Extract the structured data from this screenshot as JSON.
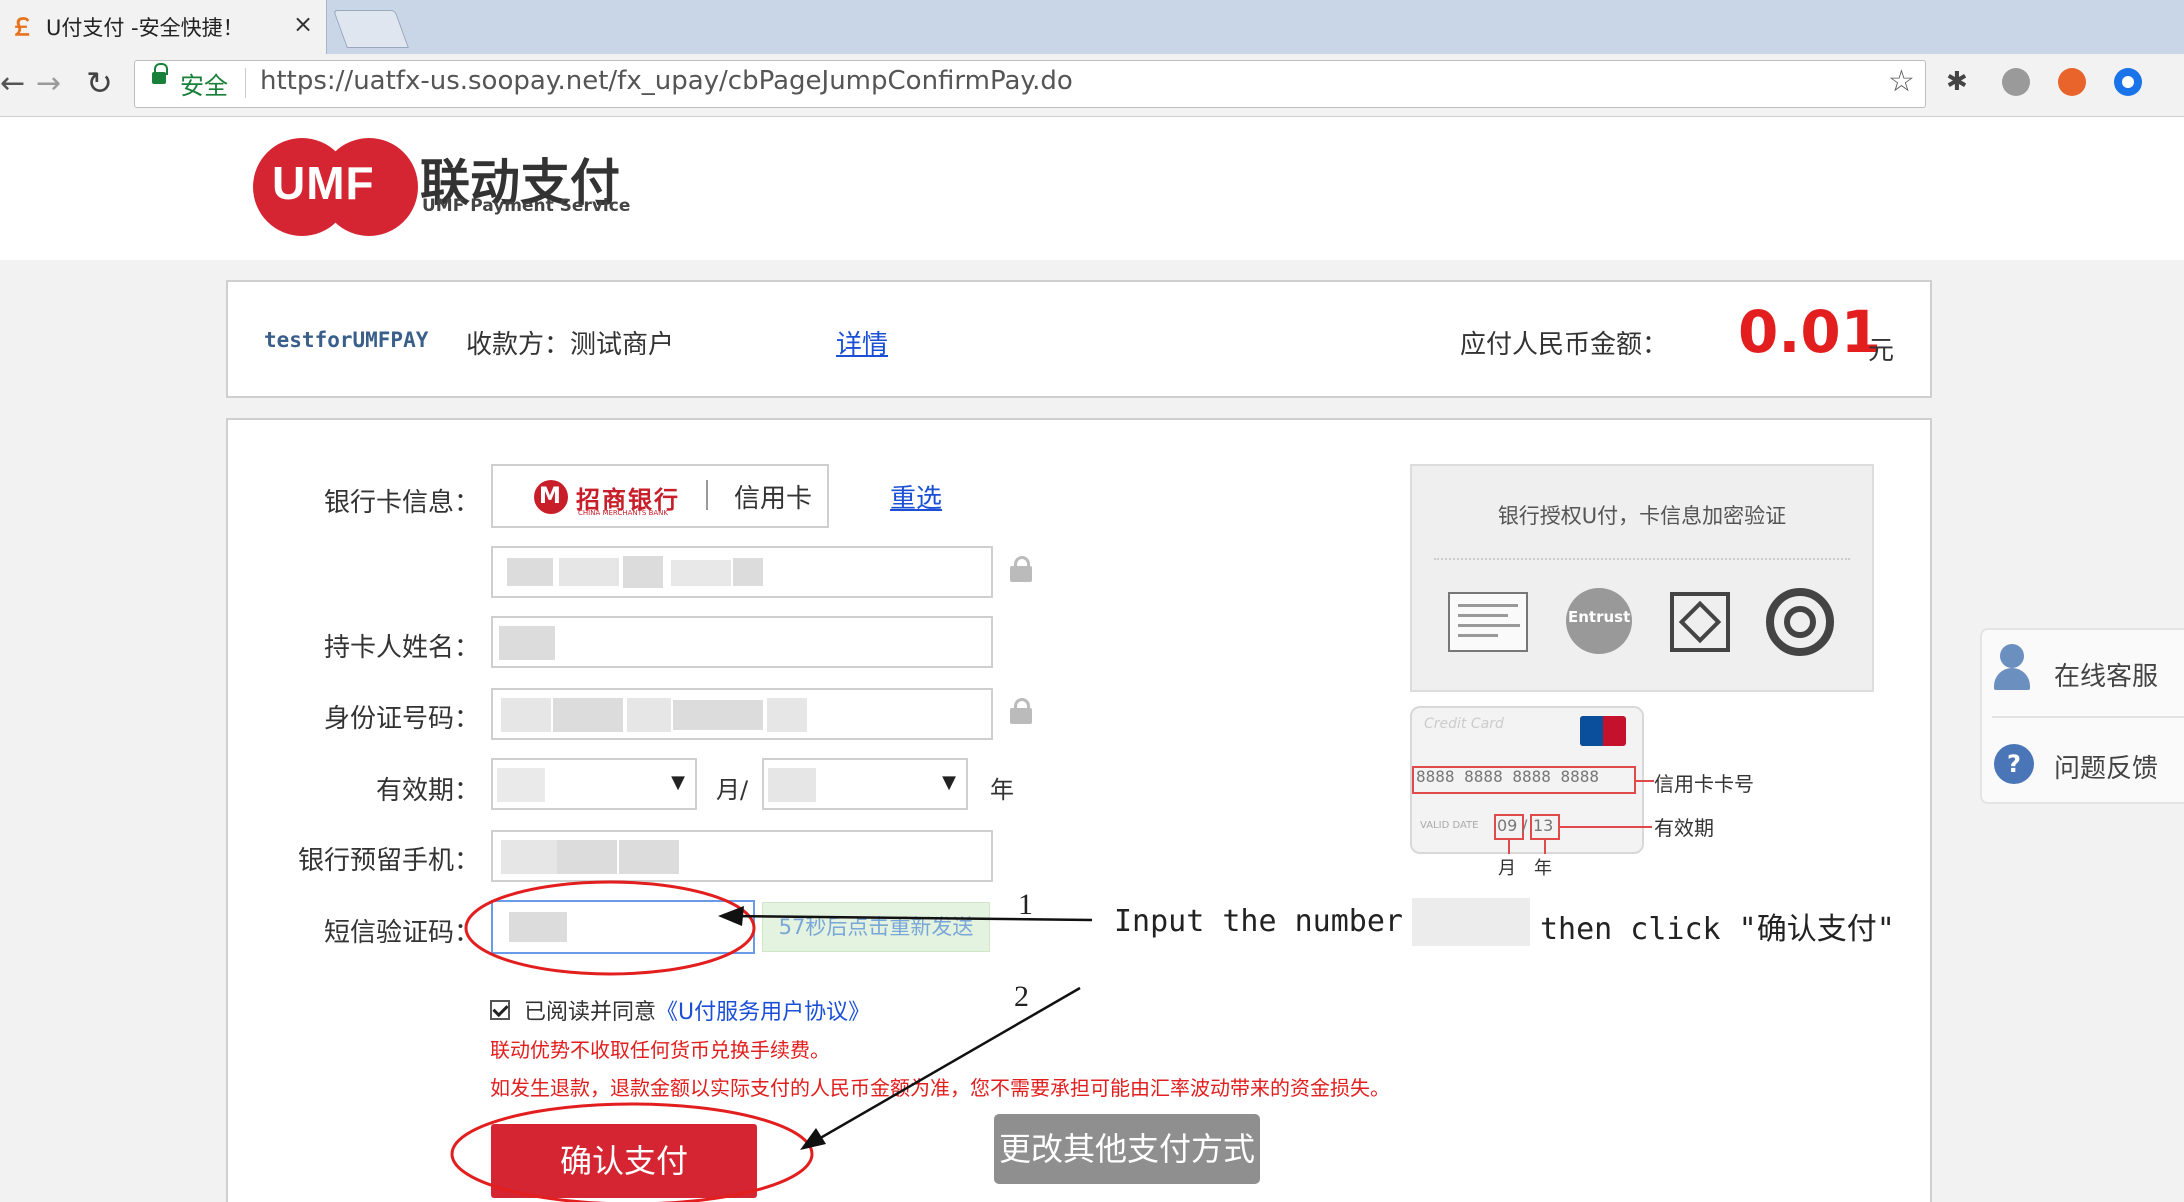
{
  "browser": {
    "tab_title": "U付支付 -安全快捷！",
    "tab_close": "×",
    "secure_label": "安全",
    "url": "https://uatfx-us.soopay.net/fx_upay/cbPageJumpConfirmPay.do",
    "icons": [
      "back-arrow-icon",
      "forward-arrow-icon",
      "reload-icon",
      "lock-icon",
      "star-icon"
    ]
  },
  "header": {
    "logo_text": "UMF",
    "brand_cn": "联动支付",
    "brand_en": "UMF Payment Service"
  },
  "merchant": {
    "order_id": "testforUMFPAY",
    "payee": "收款方：测试商户",
    "details_link": "详情",
    "amount_label": "应付人民币金额：",
    "amount": "0.01",
    "amount_unit": "元"
  },
  "form": {
    "bank_card_label": "银行卡信息：",
    "bank_name": "招商银行",
    "bank_name_en": "CHINA MERCHANTS BANK",
    "card_type": "信用卡",
    "reselect_link": "重选",
    "cardholder_label": "持卡人姓名：",
    "id_label": "身份证号码：",
    "validity_label": "有效期：",
    "month_sep": "月/",
    "year_suffix": "年",
    "phone_label": "银行预留手机：",
    "sms_label": "短信验证码：",
    "resend_button": "57秒后点击重新发送",
    "agree_text": "已阅读并同意",
    "agreement_link": "《U付服务用户协议》",
    "notice1": "联动优势不收取任何货币兑换手续费。",
    "notice2": "如发生退款，退款金额以实际支付的人民币金额为准，您不需要承担可能由汇率波动带来的资金损失。",
    "confirm_button": "确认支付",
    "change_method_button": "更改其他支付方式"
  },
  "security": {
    "title": "银行授权U付，卡信息加密验证",
    "cert_entrust": "Entrust"
  },
  "card_demo": {
    "card_label": "Credit Card",
    "number": "8888 8888 8888 8888",
    "valid_label": "VALID DATE",
    "exp_month": "09",
    "exp_year": "13",
    "number_caption": "信用卡卡号",
    "exp_caption": "有效期",
    "month_caption": "月",
    "year_caption": "年"
  },
  "side_widget": {
    "online_service": "在线客服",
    "feedback": "问题反馈",
    "feedback_icon": "?"
  },
  "annotation": {
    "step1": "1",
    "step2": "2",
    "instruction_head": "Input the number",
    "instruction_tail": "then click \"确认支付\"",
    "colors": {
      "circle": "#e21e1e",
      "arrow": "#111111"
    }
  },
  "colors": {
    "accent": "#d62532",
    "link": "#1a4fd6",
    "amount": "#e21e1e"
  }
}
